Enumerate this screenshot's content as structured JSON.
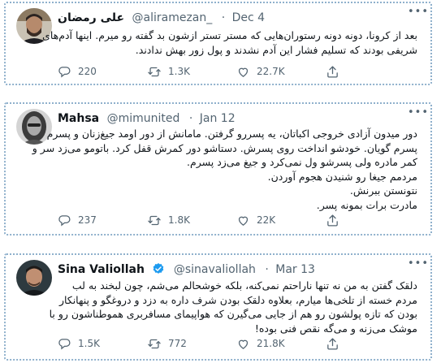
{
  "tweets": [
    {
      "name": "علی رمضان",
      "handle": "@aliramezan_",
      "date": "Dec 4",
      "text_lines": [
        "بعد از کرونا، دونه دونه رستوران‌هایی که مستر تستر ازشون بد گفته رو میرم. اینها آدم‌های",
        "شریفی بودند که تسلیم فشار این آدم نشدند و پول زور بهش ندادند."
      ],
      "replies": "220",
      "retweets": "1.3K",
      "likes": "22.7K"
    },
    {
      "name": "Mahsa",
      "handle": "@mimunited",
      "date": "Jan 12",
      "text_lines": [
        "دور میدون آزادی خروجی اکباتان، یه پسررو گرفتن. مامانش از دور اومد جیغ‌زنان و پسرم",
        "پسرم گویان. خودشو انداخت روی پسرش. دستاشو دور کمرش قفل کرد. باتومو می‌زد سر و",
        "کمر مادره ولی پسرشو ول نمی‌کرد و جیغ می‌زد پسرم.",
        "مردمم جیغا رو شنیدن هجوم آوردن.",
        "نتونستن ببرنش.",
        "مادرت برات بمونه پسر."
      ],
      "replies": "237",
      "retweets": "1.8K",
      "likes": "22K"
    },
    {
      "name": "Sina Valiollah",
      "handle": "@sinavaliollah",
      "date": "Mar 13",
      "verified": true,
      "text_lines": [
        "دلقک گفتن به من نه تنها ناراحتم نمی‌کنه، بلکه خوشحالم می‌شم، چون لبخند به لب",
        "مردم خسته از تلخی‌ها میارم، بعلاوه دلقک بودن شرف داره به دزد و دروغگو و پنهانکار",
        "بودن که تازه پولشون رو هم از جایی می‌گیرن که هواپیمای مسافربری هموطناشون رو با",
        "موشک می‌زنه و می‌گه نقص فنی بوده!"
      ],
      "replies": "1.5K",
      "retweets": "772",
      "likes": "21.8K"
    }
  ],
  "icons": {
    "reply": "reply-icon",
    "retweet": "retweet-icon",
    "like": "heart-icon",
    "share": "share-icon",
    "more": "more-options-icon",
    "verified": "verified-badge-icon"
  },
  "colors": {
    "name": "#0f1419",
    "meta": "#536471",
    "verified": "#1d9bf0",
    "border": "#8fb0cc"
  }
}
